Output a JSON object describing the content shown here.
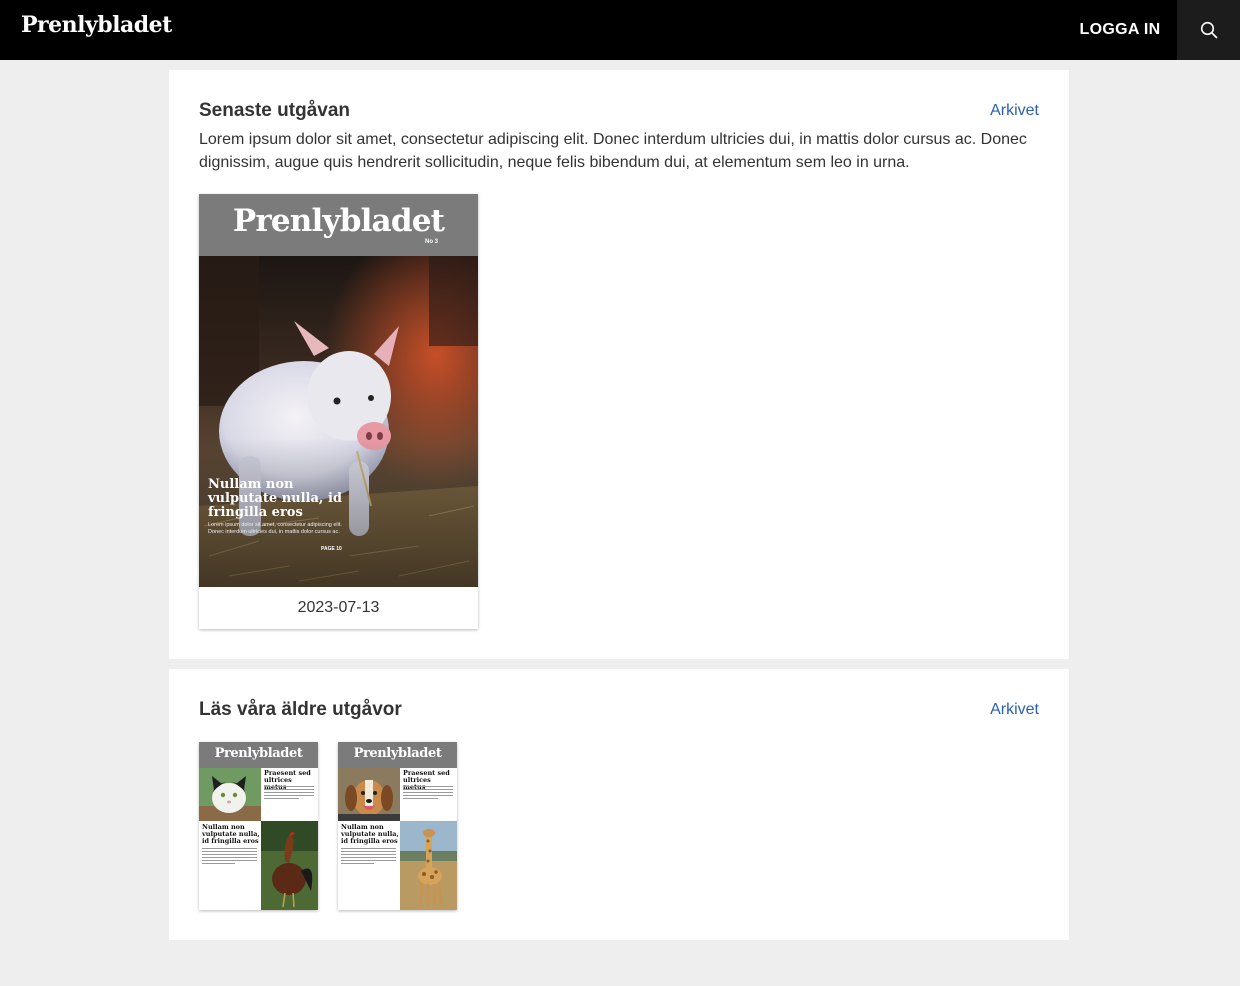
{
  "header": {
    "logo": "Prenlybladet",
    "login_label": "LOGGA IN",
    "search_icon": "search-icon"
  },
  "latest": {
    "heading": "Senaste utgåvan",
    "archive_link": "Arkivet",
    "description": "Lorem ipsum dolor sit amet, consectetur adipiscing elit. Donec interdum ultricies dui, in mattis dolor cursus ac. Donec dignissim, augue quis hendrerit sollicitudin, neque felis bibendum dui, at elementum sem leo in urna.",
    "issue": {
      "masthead": "Prenlybladet",
      "issue_no": "No 3",
      "headline": "Nullam non vulputate nulla, id fringilla eros",
      "subtext": "Lorem ipsum dolor sit amet, consectetur adipiscing elit. Donec interdum ultricies dui, in mattis dolor cursus ac.",
      "page_ref": "PAGE 10",
      "date": "2023-07-13"
    }
  },
  "older": {
    "heading": "Läs våra äldre utgåvor",
    "archive_link": "Arkivet",
    "issues": [
      {
        "masthead": "Prenlybladet",
        "headline_top": "Praesent sed ultrices metus",
        "headline_bottom": "Nullam non vulputate nulla, id fringilla eros"
      },
      {
        "masthead": "Prenlybladet",
        "headline_top": "Praesent sed ultrices metus",
        "headline_bottom": "Nullam non vulputate nulla, id fringilla eros"
      }
    ]
  },
  "colors": {
    "topbar": "#000000",
    "search_button": "#1c1c1c",
    "link": "#2b5fb3",
    "masthead": "#7b7b7b",
    "background": "#eeeeee"
  }
}
